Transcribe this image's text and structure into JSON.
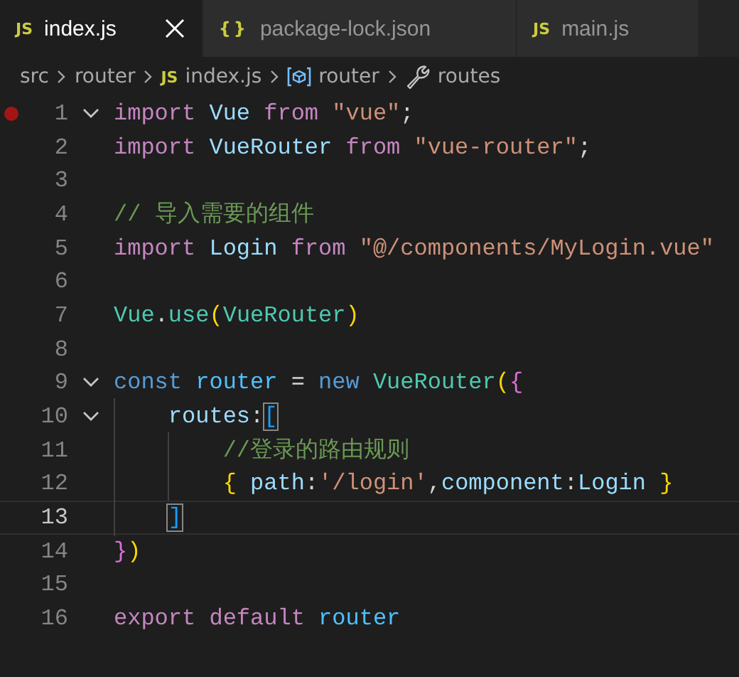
{
  "tabs": [
    {
      "label": "index.js",
      "icon_text": "JS",
      "kind": "js",
      "selected": true,
      "closable": true
    },
    {
      "label": "package-lock.json",
      "icon_text": "{}",
      "kind": "json",
      "selected": false,
      "closable": false
    },
    {
      "label": "main.js",
      "icon_text": "JS",
      "kind": "js",
      "selected": false,
      "closable": false
    }
  ],
  "breadcrumbs": [
    {
      "kind": "folder",
      "label": "src"
    },
    {
      "kind": "folder",
      "label": "router"
    },
    {
      "kind": "file",
      "icon_text": "JS",
      "label": "index.js"
    },
    {
      "kind": "variable",
      "label": "router"
    },
    {
      "kind": "property",
      "label": "routes"
    }
  ],
  "lines": [
    {
      "number": "1",
      "breakpoint": true,
      "current": false,
      "fold": {
        "expanded": true
      },
      "tokens": [
        {
          "kind": "kw",
          "t": "import "
        },
        {
          "kind": "var",
          "t": "Vue "
        },
        {
          "kind": "kw",
          "t": "from "
        },
        {
          "kind": "str",
          "t": "\"vue\""
        },
        {
          "kind": "punct",
          "t": ";"
        }
      ]
    },
    {
      "number": "2",
      "breakpoint": false,
      "current": false,
      "tokens": [
        {
          "kind": "kw",
          "t": "import "
        },
        {
          "kind": "var",
          "t": "VueRouter "
        },
        {
          "kind": "kw",
          "t": "from "
        },
        {
          "kind": "str",
          "t": "\"vue-router\""
        },
        {
          "kind": "punct",
          "t": ";"
        }
      ]
    },
    {
      "number": "3",
      "breakpoint": false,
      "current": false
    },
    {
      "number": "4",
      "breakpoint": false,
      "current": false,
      "tokens": [
        {
          "kind": "comment",
          "t": "// 导入需要的组件"
        }
      ]
    },
    {
      "number": "5",
      "breakpoint": false,
      "current": false,
      "tokens": [
        {
          "kind": "kw",
          "t": "import "
        },
        {
          "kind": "var",
          "t": "Login "
        },
        {
          "kind": "kw",
          "t": "from "
        },
        {
          "kind": "str",
          "t": "\"@/components/MyLogin.vue\""
        }
      ]
    },
    {
      "number": "6",
      "breakpoint": false,
      "current": false
    },
    {
      "number": "7",
      "breakpoint": false,
      "current": false,
      "tokens": [
        {
          "kind": "class",
          "t": "Vue"
        },
        {
          "kind": "punct",
          "t": "."
        },
        {
          "kind": "class",
          "t": "use"
        },
        {
          "kind": "b1",
          "t": "("
        },
        {
          "kind": "class",
          "t": "VueRouter"
        },
        {
          "kind": "b1",
          "t": ")"
        }
      ]
    },
    {
      "number": "8",
      "breakpoint": false,
      "current": false
    },
    {
      "number": "9",
      "breakpoint": false,
      "current": false,
      "fold": {
        "expanded": true
      },
      "tokens": [
        {
          "kind": "storage",
          "t": "const "
        },
        {
          "kind": "const",
          "t": "router "
        },
        {
          "kind": "punct",
          "t": "= "
        },
        {
          "kind": "storage",
          "t": "new "
        },
        {
          "kind": "class",
          "t": "VueRouter"
        },
        {
          "kind": "b1",
          "t": "("
        },
        {
          "kind": "b2",
          "t": "{"
        }
      ]
    },
    {
      "number": "10",
      "breakpoint": false,
      "current": false,
      "fold": {
        "expanded": true
      },
      "tokens": [
        {
          "kind": "prop",
          "t": "    routes"
        },
        {
          "kind": "punct",
          "t": ":"
        },
        {
          "kind": "b3",
          "t": "[",
          "highlighted": true
        }
      ]
    },
    {
      "number": "11",
      "breakpoint": false,
      "current": false,
      "tokens": [
        {
          "kind": "comment",
          "t": "        //登录的路由规则"
        }
      ]
    },
    {
      "number": "12",
      "breakpoint": false,
      "current": false,
      "tokens": [
        {
          "kind": "b1",
          "t": "        {"
        },
        {
          "kind": "prop",
          "t": " path"
        },
        {
          "kind": "punct",
          "t": ":"
        },
        {
          "kind": "str",
          "t": "'/login'"
        },
        {
          "kind": "punct",
          "t": ","
        },
        {
          "kind": "prop",
          "t": "component"
        },
        {
          "kind": "punct",
          "t": ":"
        },
        {
          "kind": "prop",
          "t": "Login "
        },
        {
          "kind": "b1",
          "t": "}"
        }
      ]
    },
    {
      "number": "13",
      "breakpoint": false,
      "current": true,
      "tokens": [
        {
          "kind": "b3",
          "t": "    ]",
          "highlighted": true
        }
      ]
    },
    {
      "number": "14",
      "breakpoint": false,
      "current": false,
      "tokens": [
        {
          "kind": "b2",
          "t": "}"
        },
        {
          "kind": "b1",
          "t": ")"
        }
      ]
    },
    {
      "number": "15",
      "breakpoint": false,
      "current": false
    },
    {
      "number": "16",
      "breakpoint": false,
      "current": false,
      "tokens": [
        {
          "kind": "kw",
          "t": "export "
        },
        {
          "kind": "kw",
          "t": "default "
        },
        {
          "kind": "const",
          "t": "router"
        }
      ]
    }
  ]
}
